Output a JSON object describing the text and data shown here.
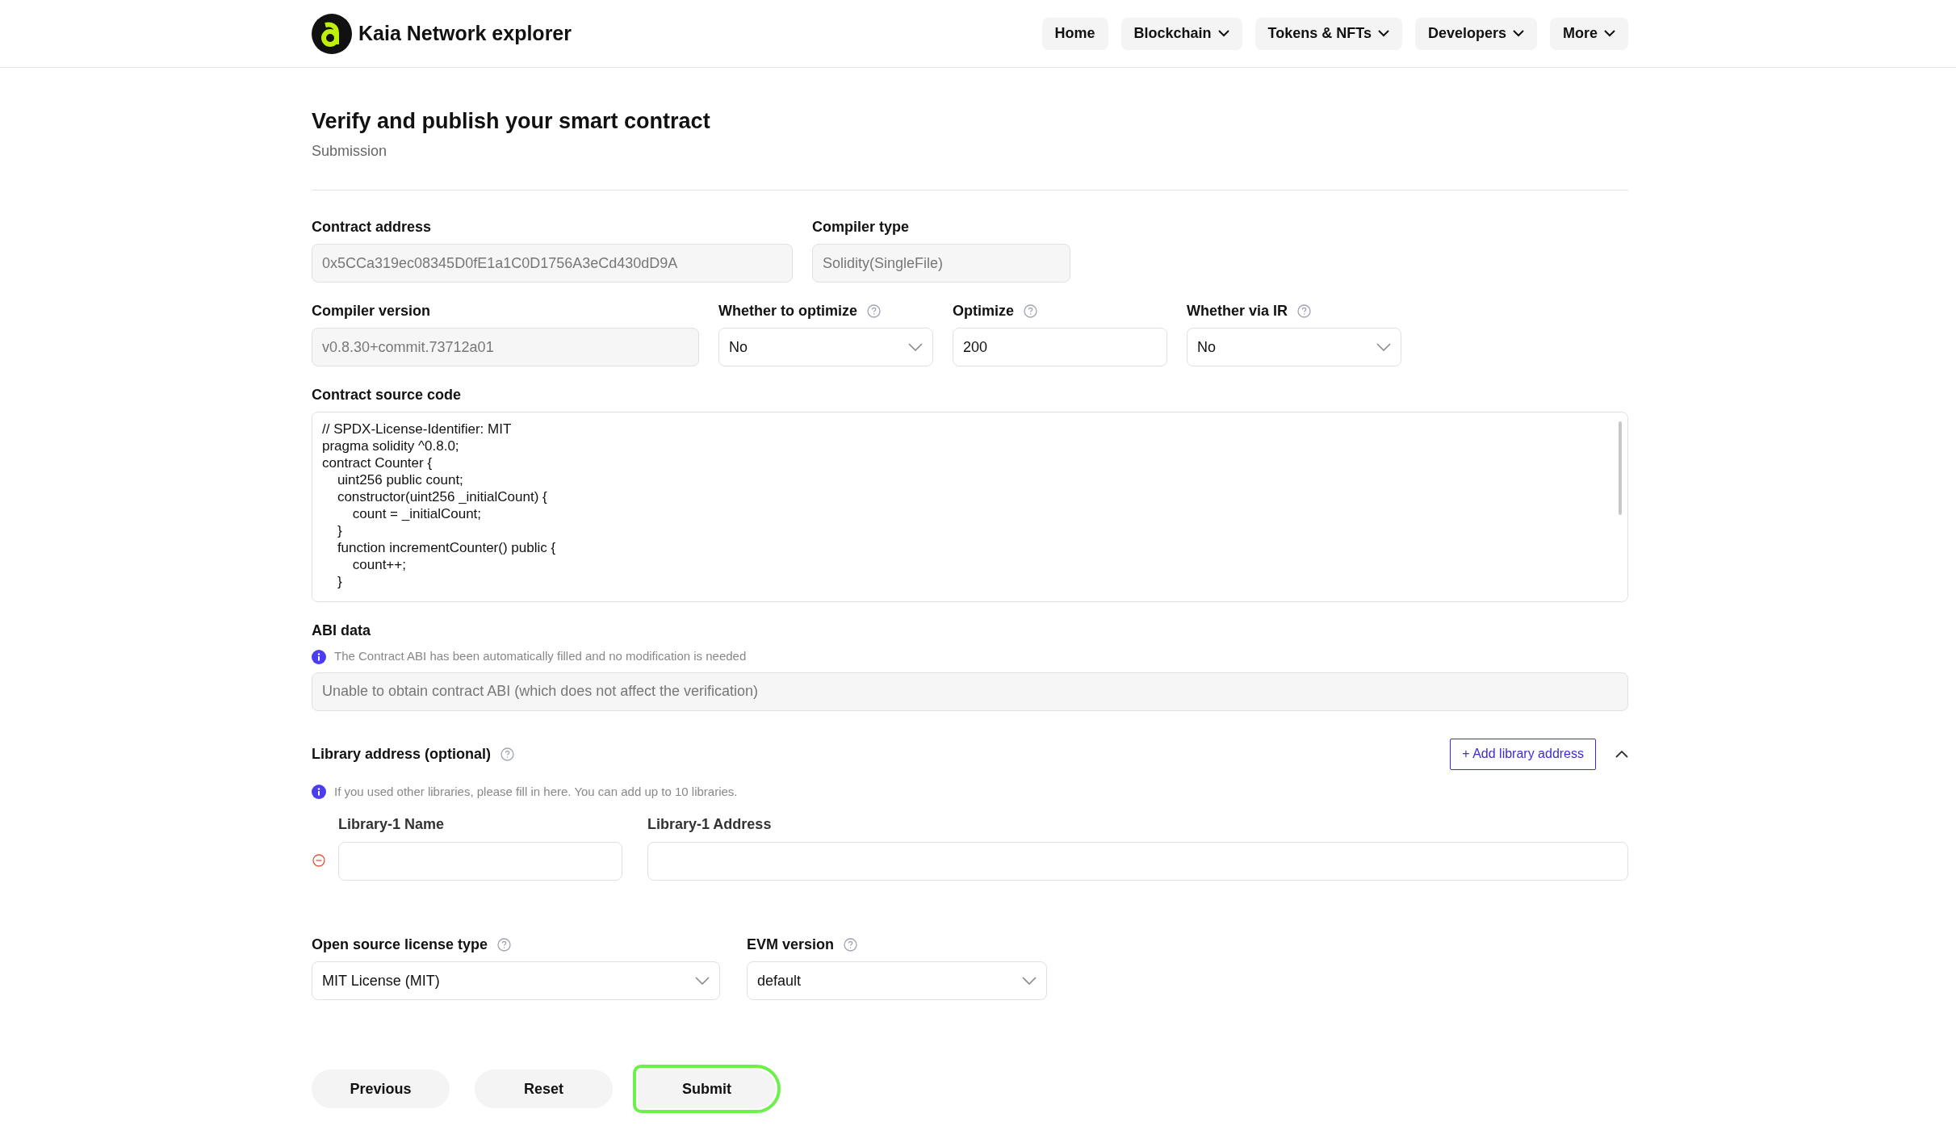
{
  "header": {
    "brand": "Kaia Network explorer",
    "nav": [
      {
        "label": "Home",
        "dropdown": false
      },
      {
        "label": "Blockchain",
        "dropdown": true
      },
      {
        "label": "Tokens & NFTs",
        "dropdown": true
      },
      {
        "label": "Developers",
        "dropdown": true
      },
      {
        "label": "More",
        "dropdown": true
      }
    ]
  },
  "page": {
    "title": "Verify and publish your smart contract",
    "subtitle": "Submission"
  },
  "rows": [
    {
      "fields": [
        {
          "label": "Contract address",
          "kind": "input",
          "value": "0x5CCa319ec08345D0fE1a1C0D1756A3eCd430dD9A",
          "disabled": true,
          "help": false
        },
        {
          "label": "Compiler type",
          "kind": "input",
          "value": "Solidity(SingleFile)",
          "disabled": true,
          "help": false
        }
      ]
    },
    {
      "fields": [
        {
          "label": "Compiler version",
          "kind": "input",
          "value": "v0.8.30+commit.73712a01",
          "disabled": true,
          "help": false
        },
        {
          "label": "Whether to optimize",
          "kind": "select",
          "value": "No",
          "disabled": false,
          "help": true
        },
        {
          "label": "Optimize",
          "kind": "input",
          "value": "200",
          "disabled": false,
          "help": true
        },
        {
          "label": "Whether via IR",
          "kind": "select",
          "value": "No",
          "disabled": false,
          "help": true
        }
      ]
    }
  ],
  "source": {
    "label": "Contract source code",
    "code": "// SPDX-License-Identifier: MIT\npragma solidity ^0.8.0;\ncontract Counter {\n    uint256 public count;\n    constructor(uint256 _initialCount) {\n        count = _initialCount;\n    }\n    function incrementCounter() public {\n        count++;\n    }"
  },
  "abi": {
    "label": "ABI data",
    "info": "The Contract ABI has been automatically filled and no modification is needed",
    "value": "Unable to obtain contract ABI (which does not affect the verification)"
  },
  "library": {
    "label": "Library address (optional)",
    "add_button": "+ Add library address",
    "expanded": true,
    "info": "If you used other libraries, please fill in here. You can add up to 10 libraries.",
    "entries": [
      {
        "name_label": "Library-1 Name",
        "address_label": "Library-1 Address"
      }
    ]
  },
  "bottom": {
    "fields": [
      {
        "label": "Open source license type",
        "kind": "select",
        "value": "MIT License (MIT)",
        "disabled": false,
        "help": true
      },
      {
        "label": "EVM version",
        "kind": "select",
        "value": "default",
        "disabled": false,
        "help": true
      }
    ]
  },
  "buttons": [
    {
      "label": "Previous",
      "highlighted": false
    },
    {
      "label": "Reset",
      "highlighted": false
    },
    {
      "label": "Submit",
      "highlighted": true
    }
  ]
}
